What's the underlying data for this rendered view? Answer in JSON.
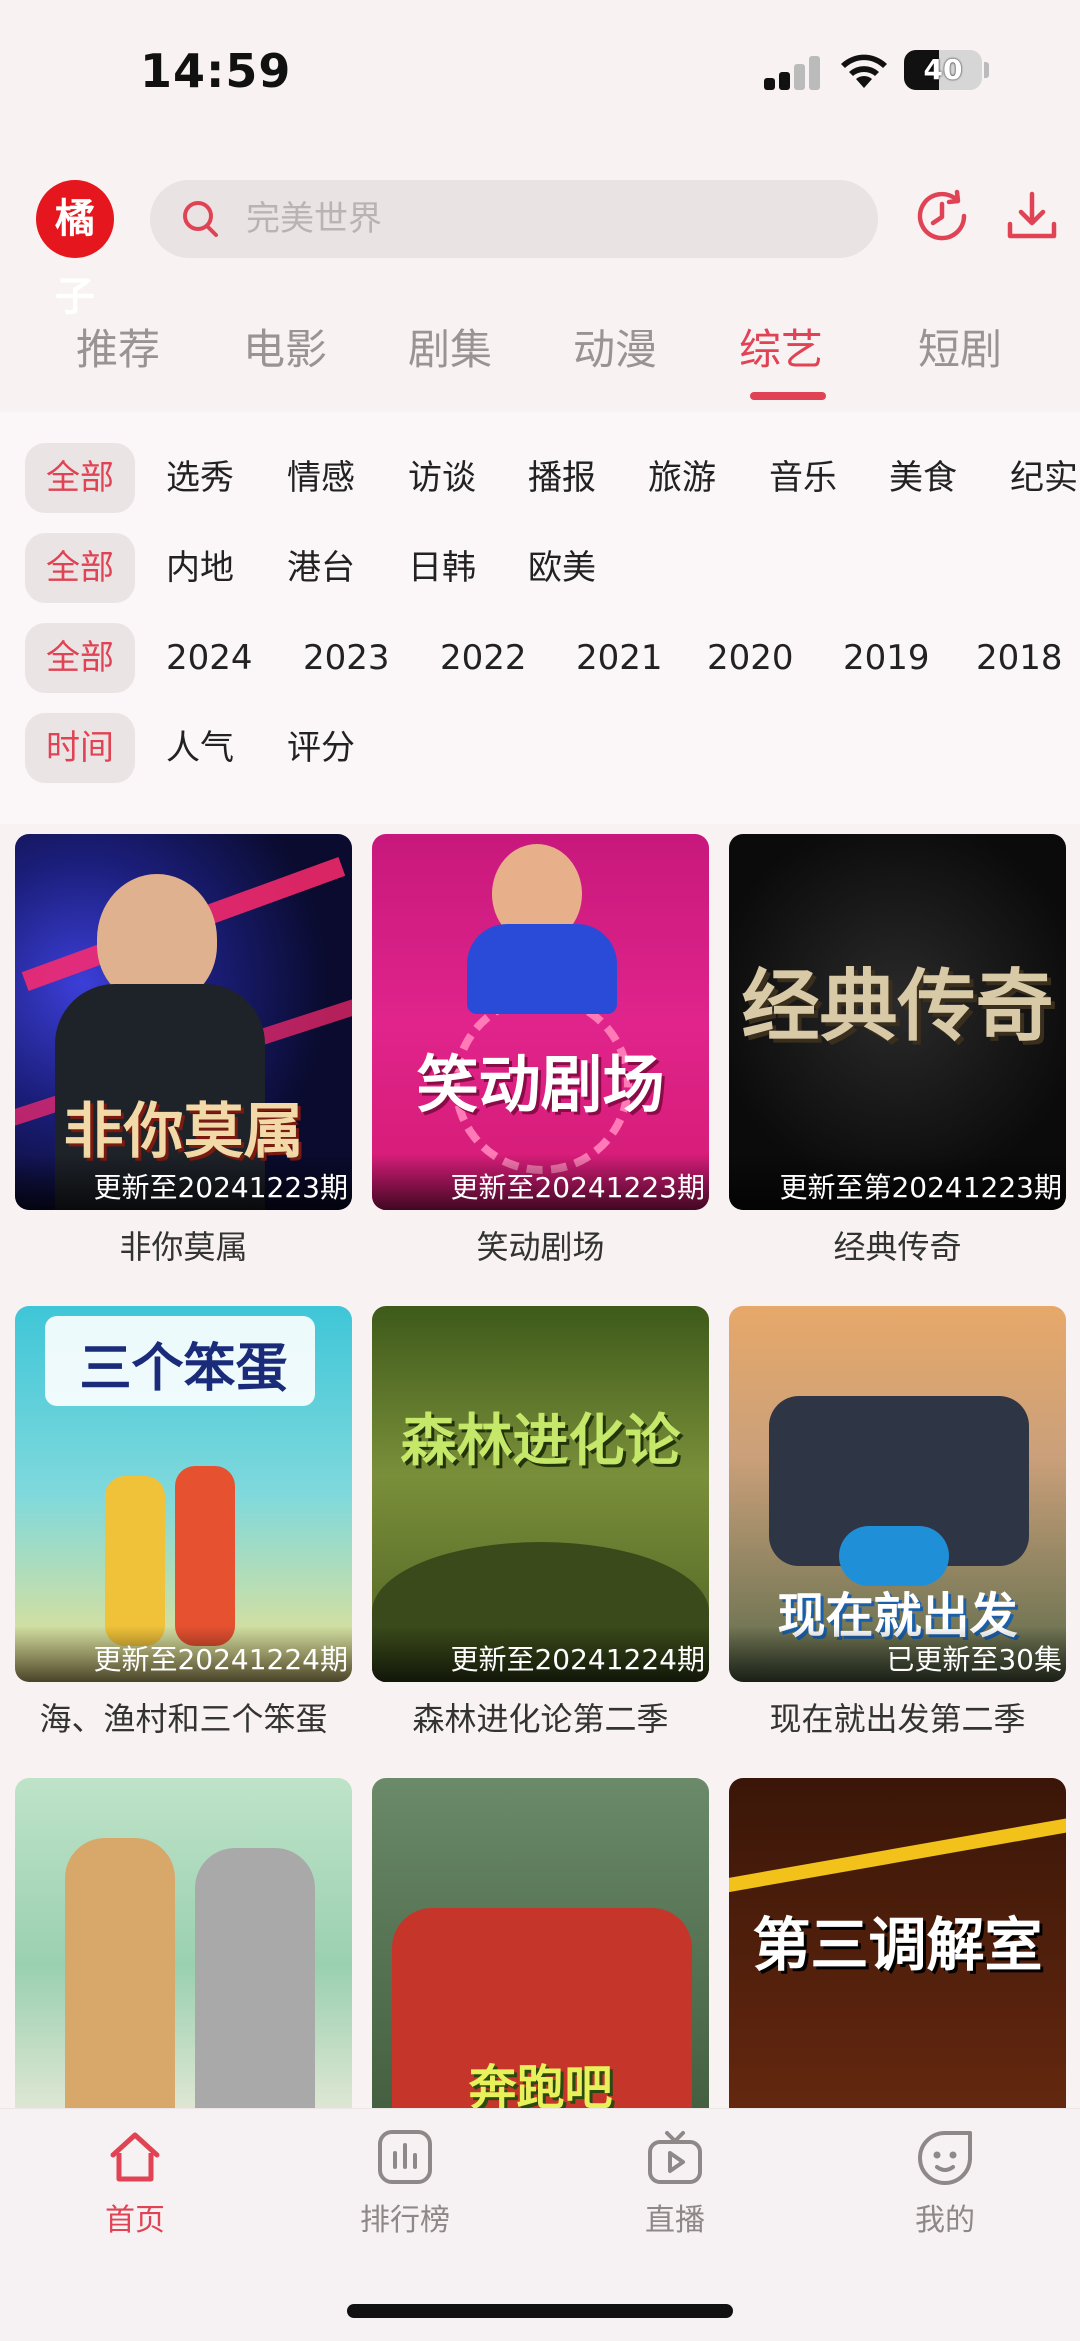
{
  "status": {
    "time": "14:59",
    "battery": "40"
  },
  "header": {
    "logo_text": "橘子",
    "search_placeholder": "完美世界"
  },
  "tabs": [
    "推荐",
    "电影",
    "剧集",
    "动漫",
    "综艺",
    "短剧"
  ],
  "active_tab": "综艺",
  "filters": {
    "type": [
      "全部",
      "选秀",
      "情感",
      "访谈",
      "播报",
      "旅游",
      "音乐",
      "美食",
      "纪实"
    ],
    "region": [
      "全部",
      "内地",
      "港台",
      "日韩",
      "欧美"
    ],
    "year": [
      "全部",
      "2024",
      "2023",
      "2022",
      "2021",
      "2020",
      "2019",
      "2018"
    ],
    "sort": [
      "时间",
      "人气",
      "评分"
    ]
  },
  "shows": [
    {
      "title": "非你莫属",
      "update": "更新至20241223期",
      "poster_text": "非你莫属"
    },
    {
      "title": "笑动剧场",
      "update": "更新至20241223期",
      "poster_text": "笑动剧场"
    },
    {
      "title": "经典传奇",
      "update": "更新至第20241223期",
      "poster_text": "经典传奇"
    },
    {
      "title": "海、渔村和三个笨蛋",
      "update": "更新至20241224期",
      "poster_text": "三个笨蛋"
    },
    {
      "title": "森林进化论第二季",
      "update": "更新至20241224期",
      "poster_text": "森林进化论"
    },
    {
      "title": "现在就出发第二季",
      "update": "已更新至30集",
      "poster_text": "现在就出发"
    },
    {
      "title": "",
      "update": "",
      "poster_text": ""
    },
    {
      "title": "",
      "update": "",
      "poster_text": "奔跑吧"
    },
    {
      "title": "",
      "update": "",
      "poster_text": "第三调解室"
    }
  ],
  "bottom_nav": [
    "首页",
    "排行榜",
    "直播",
    "我的"
  ],
  "colors": {
    "accent": "#e04454",
    "logo": "#e5161d"
  }
}
